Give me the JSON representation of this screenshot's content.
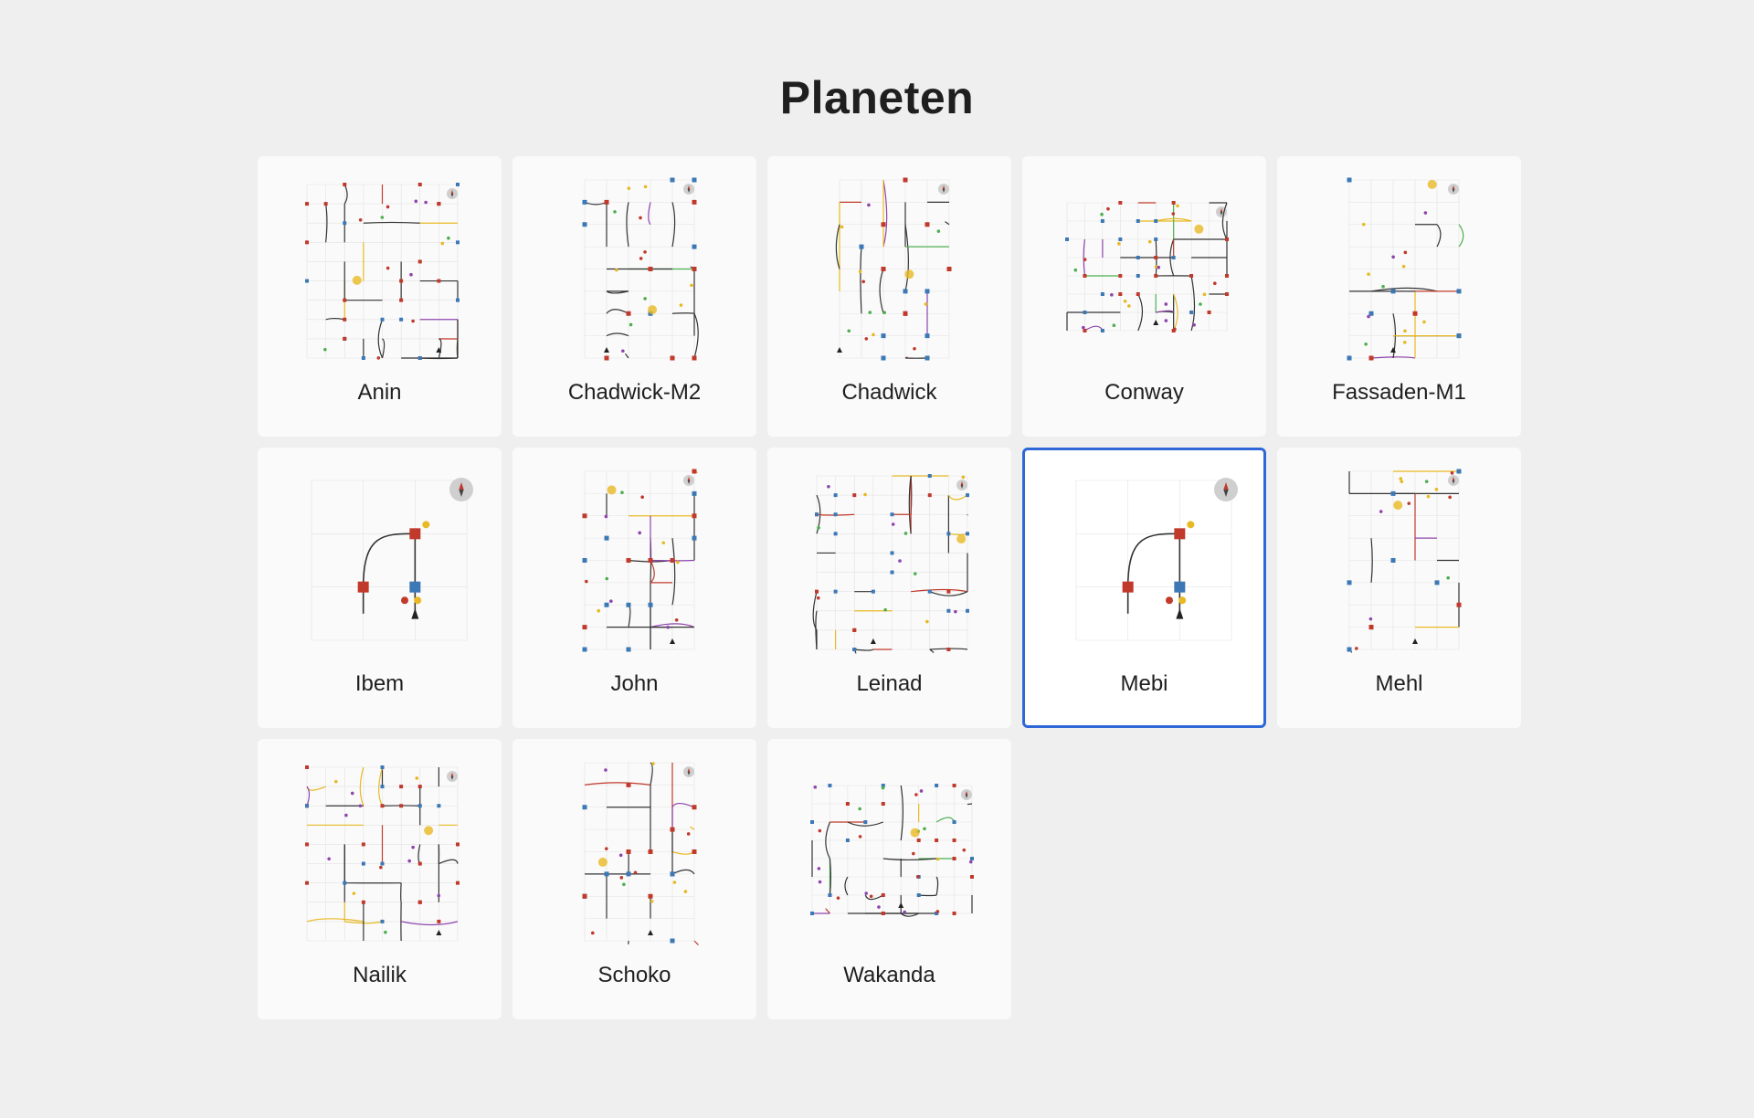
{
  "header": {
    "title": "Planeten"
  },
  "planets": [
    {
      "name": "Anin",
      "style": "maze",
      "selected": false
    },
    {
      "name": "Chadwick-M2",
      "style": "tall",
      "selected": false
    },
    {
      "name": "Chadwick",
      "style": "tall",
      "selected": false
    },
    {
      "name": "Conway",
      "style": "dense",
      "selected": false
    },
    {
      "name": "Fassaden-M1",
      "style": "tall-sparse",
      "selected": false
    },
    {
      "name": "Ibem",
      "style": "simple",
      "selected": false
    },
    {
      "name": "John",
      "style": "tall",
      "selected": false
    },
    {
      "name": "Leinad",
      "style": "maze",
      "selected": false
    },
    {
      "name": "Mebi",
      "style": "simple",
      "selected": true
    },
    {
      "name": "Mehl",
      "style": "tall-sparse",
      "selected": false
    },
    {
      "name": "Nailik",
      "style": "maze",
      "selected": false
    },
    {
      "name": "Schoko",
      "style": "tall",
      "selected": false
    },
    {
      "name": "Wakanda",
      "style": "dense",
      "selected": false
    }
  ],
  "colors": {
    "background": "#efefef",
    "card": "#fafafa",
    "selected_border": "#2f68d6",
    "path": "#333333",
    "node_red": "#c0392b",
    "node_blue": "#3b78b5",
    "accent_yellow": "#e8b923",
    "accent_green": "#4caf50",
    "accent_purple": "#8e44ad"
  },
  "icons": {
    "compass": "compass-icon"
  }
}
